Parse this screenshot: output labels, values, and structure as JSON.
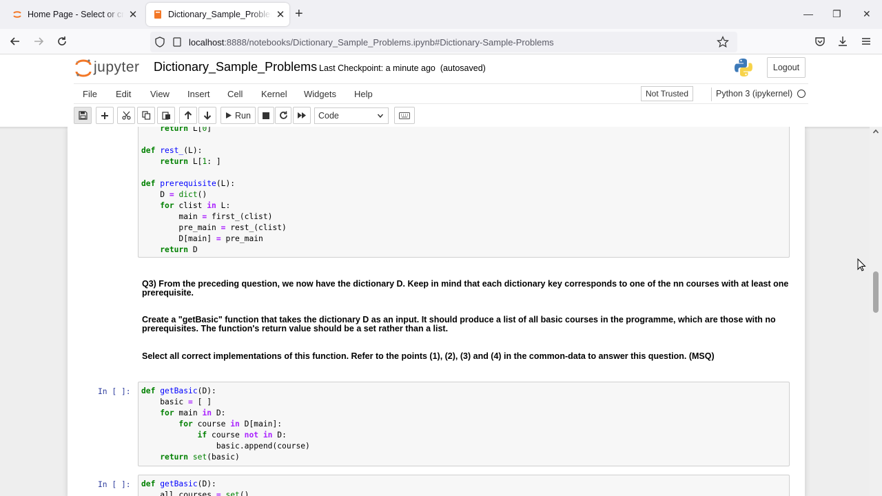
{
  "browser": {
    "tabs": [
      {
        "title": "Home Page - Select or create a notebook",
        "active": false
      },
      {
        "title": "Dictionary_Sample_Problems - Jupyter Notebook",
        "active": true
      }
    ],
    "url_host": "localhost",
    "url_rest": ":8888/notebooks/Dictionary_Sample_Problems.ipynb#Dictionary-Sample-Problems"
  },
  "jupyter": {
    "logo_text": "jupyter",
    "notebook_name": "Dictionary_Sample_Problems",
    "checkpoint": "Last Checkpoint: a minute ago",
    "autosave": "(autosaved)",
    "logout_label": "Logout"
  },
  "menu": {
    "items": [
      "File",
      "Edit",
      "View",
      "Insert",
      "Cell",
      "Kernel",
      "Widgets",
      "Help"
    ],
    "trust_label": "Not Trusted",
    "kernel_label": "Python 3 (ipykernel)"
  },
  "toolbar": {
    "run_label": "Run",
    "cell_type": "Code"
  },
  "cells": {
    "prompt_1": "In [ ]:",
    "prompt_2": "In [ ]:",
    "md_q3": "Q3) From the preceding question, we now have the dictionary D. Keep in mind that each dictionary key corresponds to one of the nn courses with at least one prerequisite.",
    "md_create": "Create a \"getBasic\" function that takes the dictionary D as an input. It should produce a list of all basic courses in the programme, which are those with no prerequisites. The function's return value should be a set rather than a list.",
    "md_select": "Select all correct implementations of this function. Refer to the points (1), (2), (3) and (4) in the common-data to answer this question. (MSQ)"
  },
  "colors": {
    "prompt_blue": "#303f9f",
    "keyword_green": "#008000",
    "function_blue": "#0000ff",
    "operator_purple": "#aa22ff",
    "jupyter_orange": "#f37726"
  }
}
